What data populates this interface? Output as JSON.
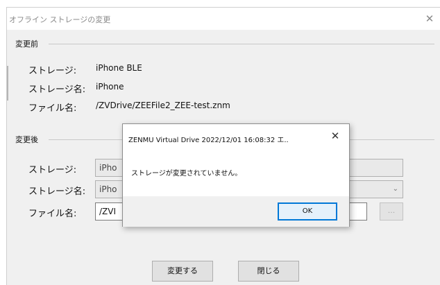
{
  "window": {
    "title": "オフライン ストレージの変更",
    "close_glyph": "✕"
  },
  "before": {
    "section_label": "変更前",
    "storage_label": "ストレージ:",
    "storage_value": "iPhone BLE",
    "storage_name_label": "ストレージ名:",
    "storage_name_value": "iPhone",
    "file_name_label": "ファイル名:",
    "file_name_value": "/ZVDrive/ZEEFile2_ZEE-test.znm"
  },
  "after": {
    "section_label": "変更後",
    "storage_label": "ストレージ:",
    "storage_value": "iPho",
    "storage_name_label": "ストレージ名:",
    "storage_name_value": "iPho",
    "file_name_label": "ファイル名:",
    "file_name_value": "/ZVI",
    "browse_label": "...",
    "combo_arrow": "⌄"
  },
  "buttons": {
    "change_label": "変更する",
    "close_label": "閉じる"
  },
  "message_box": {
    "title": "ZENMU Virtual Drive 2022/12/01 16:08:32 エ..",
    "close_glyph": "✕",
    "message": "ストレージが変更されていません。",
    "ok_label": "OK"
  }
}
